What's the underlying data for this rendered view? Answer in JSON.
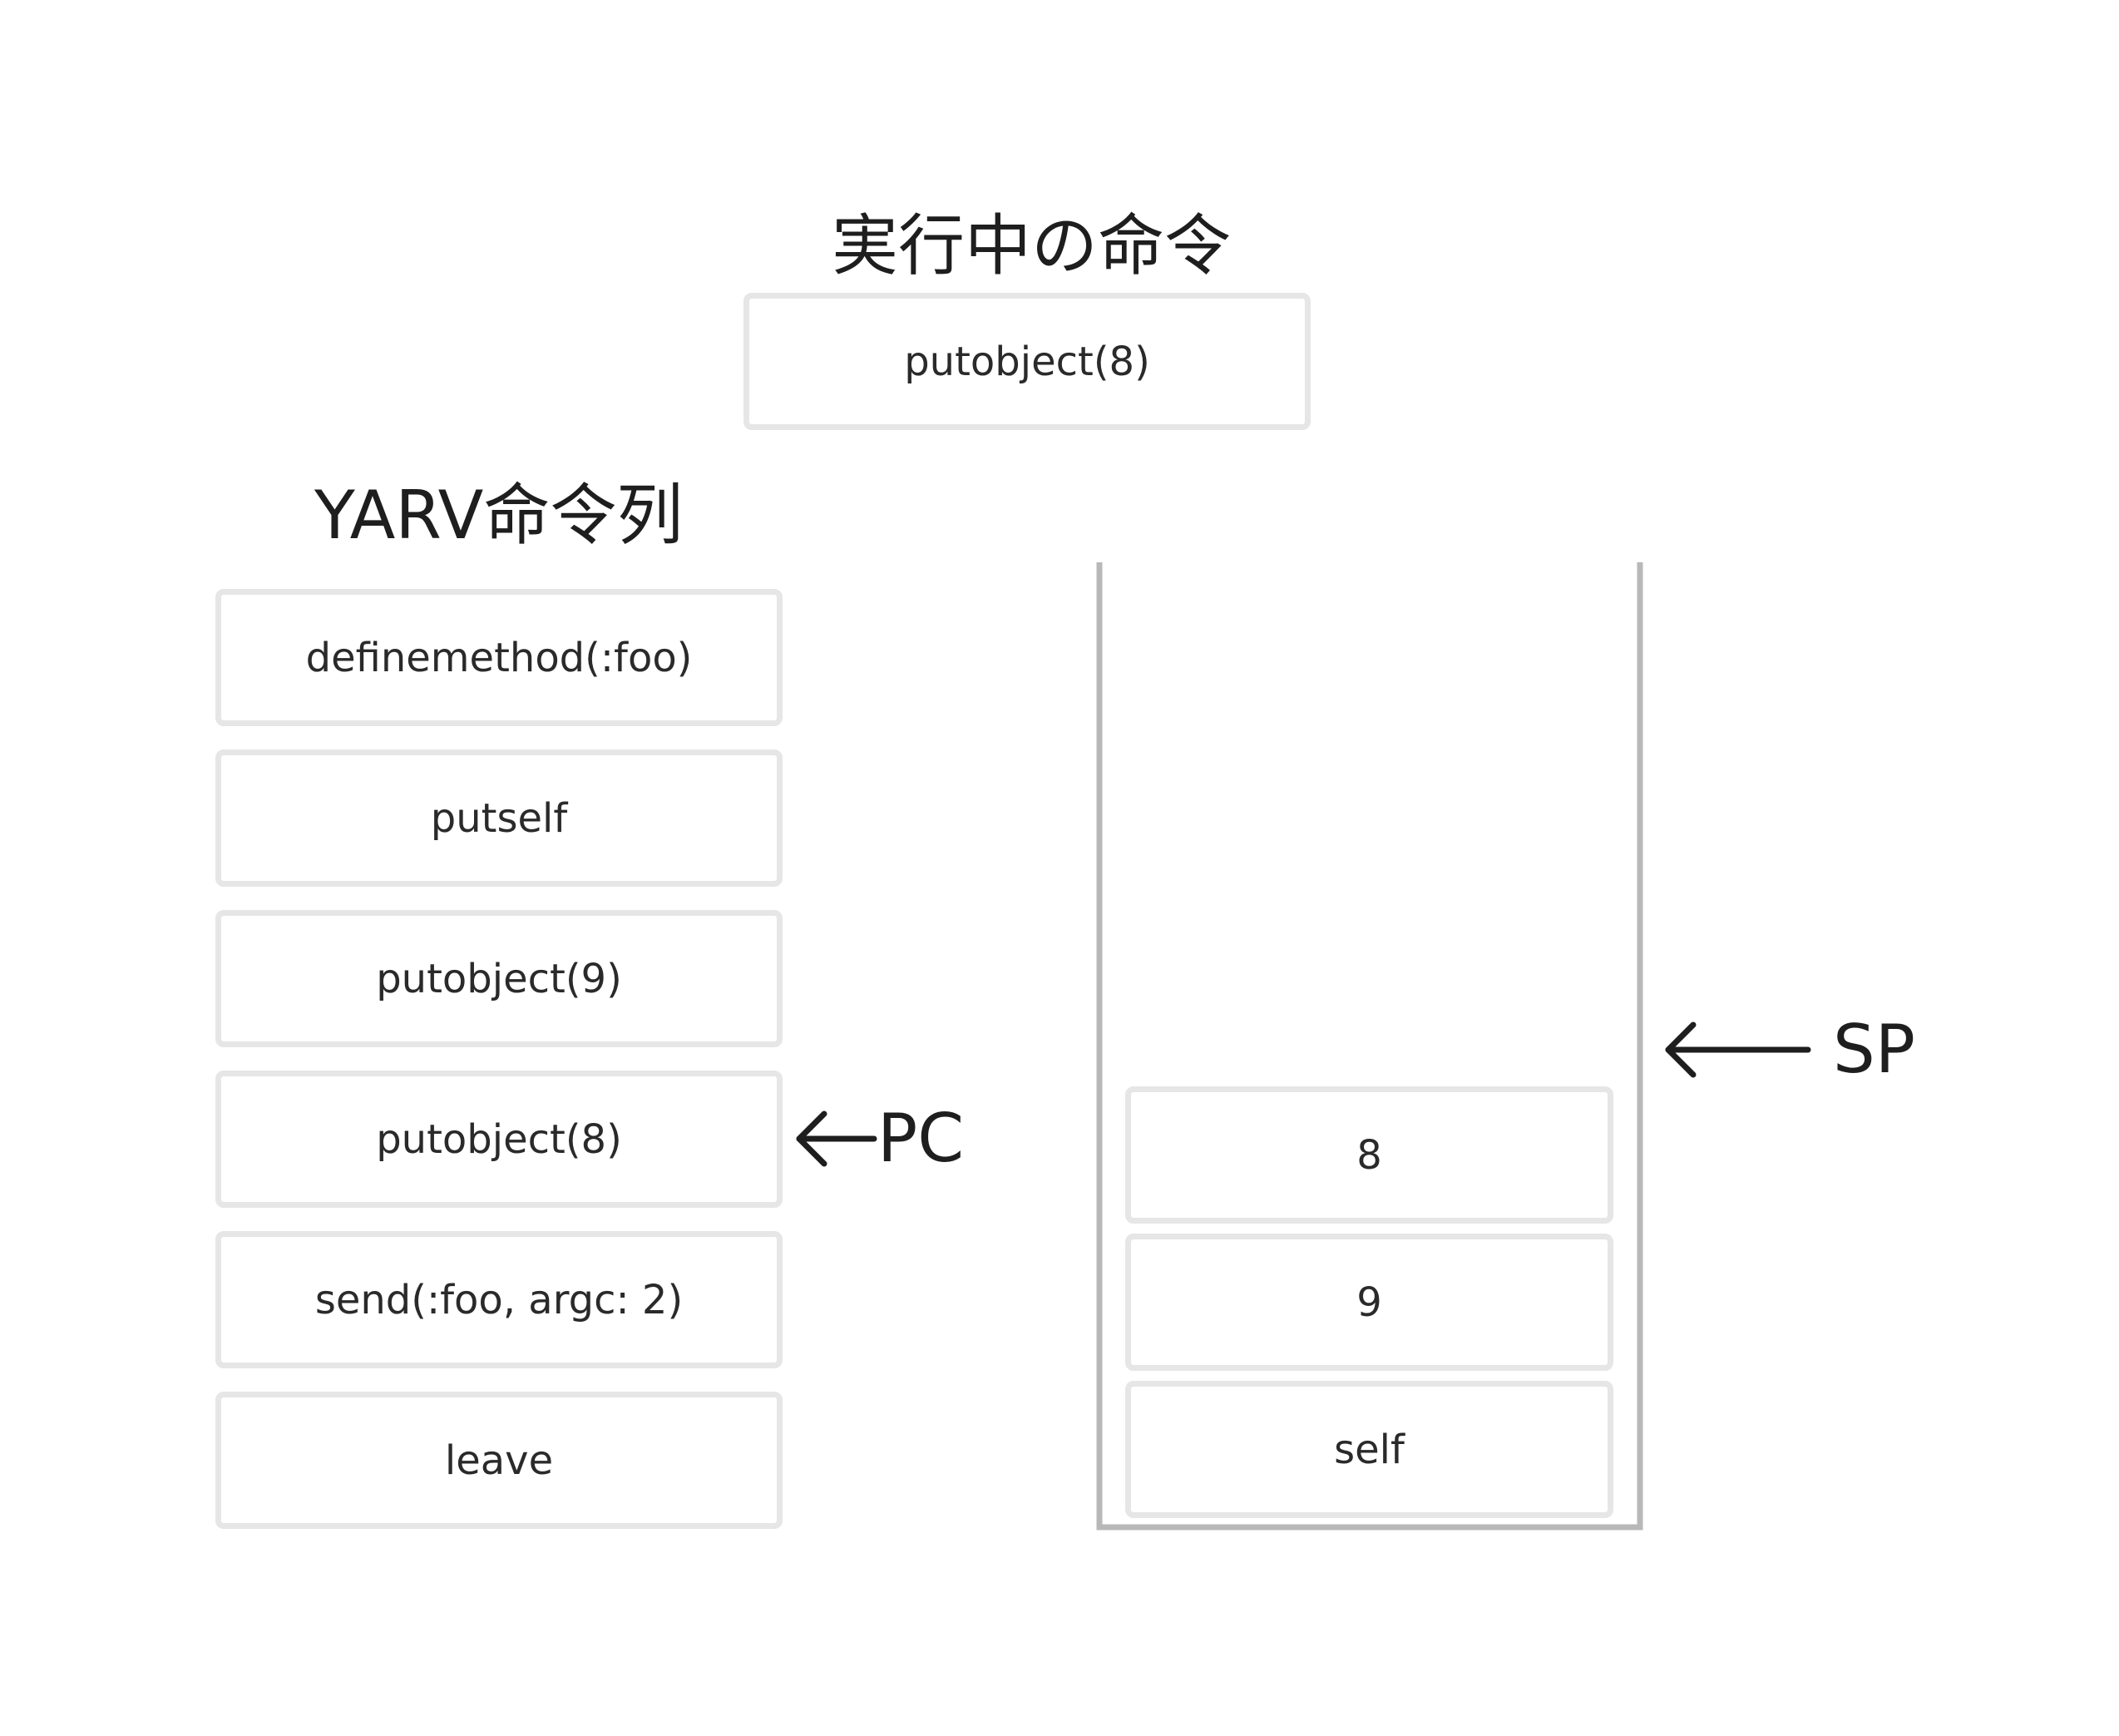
{
  "current_instruction": {
    "title": "実行中の命令",
    "value": "putobject(8)"
  },
  "instruction_sequence": {
    "title": "YARV命令列",
    "items": [
      "definemethod(:foo)",
      "putself",
      "putobject(9)",
      "putobject(8)",
      "send(:foo, argc: 2)",
      "leave"
    ],
    "pointer_label": "PC",
    "pointer_index": 3
  },
  "stack": {
    "items_top_to_bottom": [
      "8",
      "9",
      "self"
    ],
    "pointer_label": "SP"
  },
  "colors": {
    "box_border": "#e6e6e6",
    "stack_wall": "#b8b8b8",
    "text": "#1e1e1e"
  }
}
